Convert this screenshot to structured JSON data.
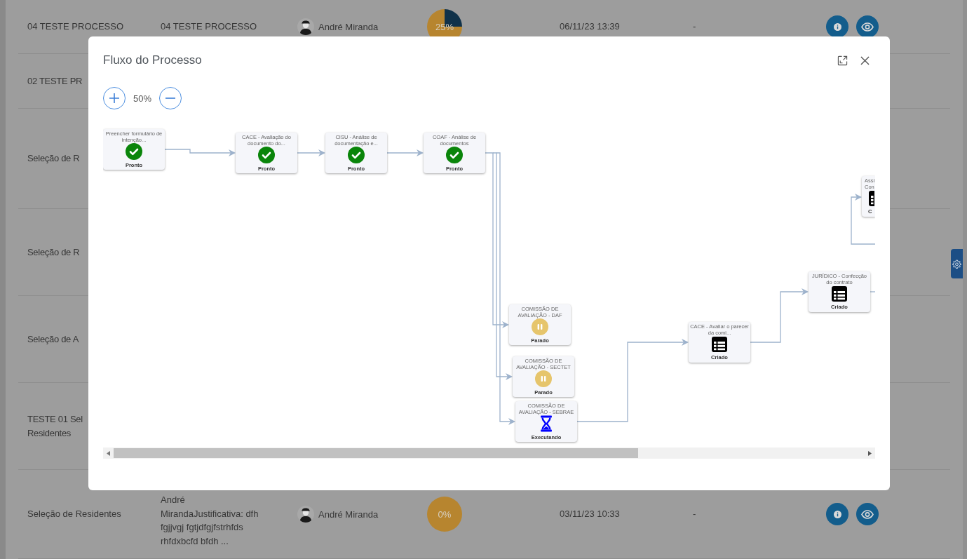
{
  "background_table": {
    "rows": [
      {
        "column_1": "04 TESTE PROCESSO",
        "column_2": "04 TESTE PROCESSO",
        "user": "André Miranda",
        "progress": {
          "label": "25%",
          "chart_data": {
            "type": "pie",
            "values": [
              25,
              75
            ]
          }
        },
        "date": "06/11/23 13:39",
        "column_6": "-",
        "actions": [
          {
            "kind": "info"
          },
          {
            "kind": "view"
          }
        ]
      },
      {
        "column_1": "02 TESTE PR"
      },
      {
        "column_1": "Seleção de R"
      },
      {
        "column_1": "Seleção de R"
      },
      {
        "column_1": "Seleção de A"
      },
      {
        "column_1": "TESTE 01 Sel Residentes"
      },
      {
        "column_1": "Seleção de Residentes",
        "column_2": "André MirandaJustificativa: dfh fgjjvgj fgtjdfgjfstrhfds rhfdxbcfd bfdh ...",
        "user": "André Miranda",
        "progress": {
          "label": "0%",
          "chart_data": {
            "type": "pie",
            "values": [
              0,
              100
            ]
          }
        },
        "date": "03/11/23 10:33",
        "column_6": "-",
        "actions": [
          {
            "kind": "info"
          },
          {
            "kind": "view"
          }
        ]
      }
    ]
  },
  "modal": {
    "title": "Fluxo do Processo",
    "zoom": {
      "label": "50%"
    },
    "nodes": [
      {
        "title": "Preencher formulário de intenção...",
        "status": "Pronto",
        "kind": "done"
      },
      {
        "title": "CACE - Avaliação do documento do...",
        "status": "Pronto",
        "kind": "done"
      },
      {
        "title": "CISU - Análise de documentação e...",
        "status": "Pronto",
        "kind": "done"
      },
      {
        "title": "COAF - Análise de documentos",
        "status": "Pronto",
        "kind": "done"
      },
      {
        "title": "COMISSÃO DE AVALIAÇÃO - DAF",
        "status": "Parado",
        "kind": "paused"
      },
      {
        "title": "COMISSÃO DE AVALIAÇÃO - SECTET",
        "status": "Parado",
        "kind": "paused"
      },
      {
        "title": "COMISSÃO DE AVALIAÇÃO - SEBRAE",
        "status": "Executando",
        "kind": "running"
      },
      {
        "title": "CACE - Avaliar o parecer da comi...",
        "status": "Criado",
        "kind": "created"
      },
      {
        "title": "JURÍDICO - Confecção do contrato",
        "status": "Criado",
        "kind": "created"
      },
      {
        "title": "Assi Con",
        "status": "C",
        "kind": "created"
      }
    ]
  }
}
